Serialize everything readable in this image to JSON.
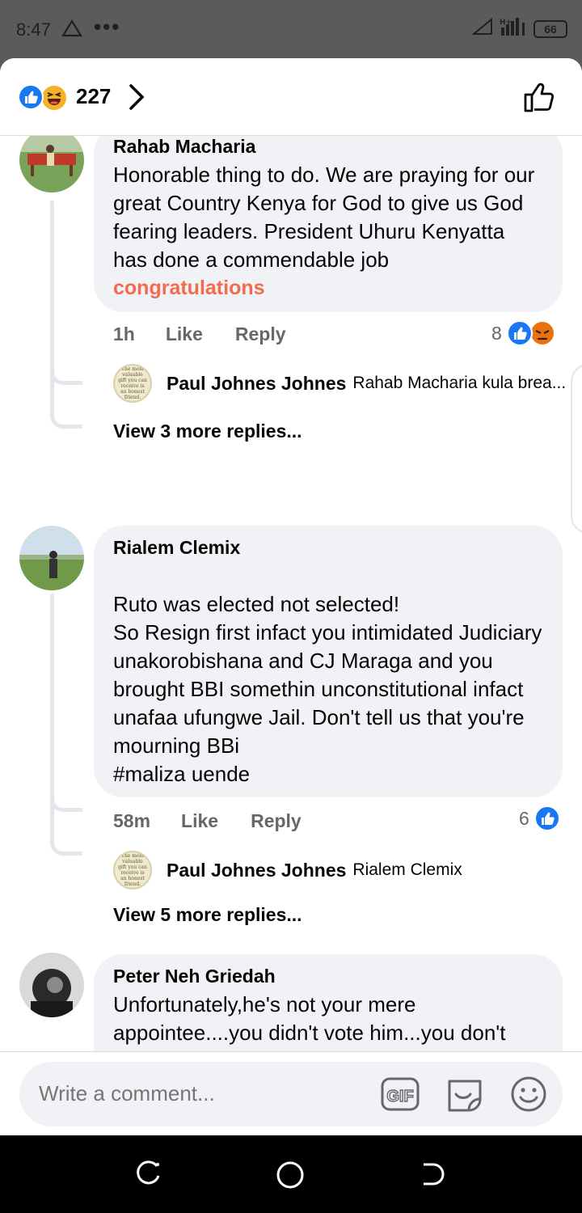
{
  "status_bar": {
    "time": "8:47",
    "dots": "•••",
    "battery": "66"
  },
  "header": {
    "reaction_count": "227"
  },
  "comments": [
    {
      "author": "Rahab Macharia",
      "text": "Honorable thing to do. We are praying for our great Country Kenya for God to give us God fearing leaders. President Uhuru Kenyatta has done a commendable job",
      "link_text": "congratulations",
      "time": "1h",
      "like_label": "Like",
      "reply_label": "Reply",
      "reaction_count": "8",
      "reply_preview": {
        "author": "Paul Johnes Johnes",
        "text": "Rahab Macharia kula brea..."
      },
      "view_more": "View 3 more replies..."
    },
    {
      "author": "Rialem Clemix",
      "text": "\nRuto was elected not selected!\nSo Resign first infact you intimidated Judiciary unakorobishana and CJ  Maraga and you brought BBI somethin unconstitutional infact unafaa ufungwe Jail. Don't tell us that you're mourning BBi\n#maliza uende",
      "time": "58m",
      "like_label": "Like",
      "reply_label": "Reply",
      "reaction_count": "6",
      "reply_preview": {
        "author": "Paul Johnes Johnes",
        "text": "Rialem Clemix"
      },
      "view_more": "View 5 more replies..."
    },
    {
      "author": "Peter Neh Griedah",
      "text": "Unfortunately,he's not your mere appointee....you didn't vote him...you don't pay him .......it's the people that voted & it's thru them both of you are paid..........sounds"
    }
  ],
  "reply_avatar_text": "The most valuable gift you can receive is an honest friend.",
  "composer": {
    "placeholder": "Write a comment...",
    "gif_label": "GIF"
  },
  "colors": {
    "facebook_blue": "#1877f2",
    "link_orange": "#f26b4f",
    "bubble_gray": "#f0f2f5",
    "meta_gray": "#65676b"
  }
}
